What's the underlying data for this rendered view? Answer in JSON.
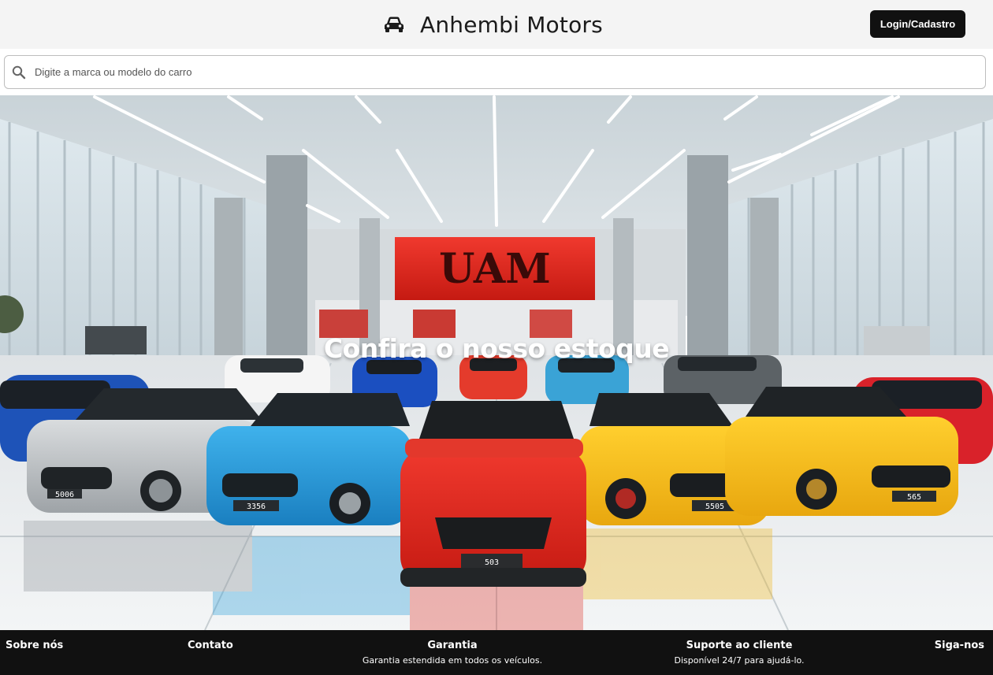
{
  "header": {
    "brand_icon": "car-icon",
    "title": "Anhembi Motors",
    "login_label": "Login/Cadastro"
  },
  "search": {
    "icon": "search-icon",
    "placeholder": "Digite a marca ou modelo do carro",
    "value": ""
  },
  "hero": {
    "heading": "Confira o nosso estoque",
    "sign_text": "UAM",
    "plates": [
      "5006",
      "3356",
      "503",
      "5505",
      "565"
    ]
  },
  "footer": {
    "about": {
      "heading": "Sobre nós"
    },
    "contact": {
      "heading": "Contato"
    },
    "warranty": {
      "heading": "Garantia",
      "text": "Garantia estendida em todos os veículos."
    },
    "support": {
      "heading": "Suporte ao cliente",
      "text": "Disponível 24/7 para ajudá-lo."
    },
    "social": {
      "heading": "Siga-nos"
    }
  },
  "colors": {
    "header_bg": "#f4f4f4",
    "button_bg": "#111111",
    "footer_bg": "#111111",
    "sign_red": "#e8231c"
  }
}
